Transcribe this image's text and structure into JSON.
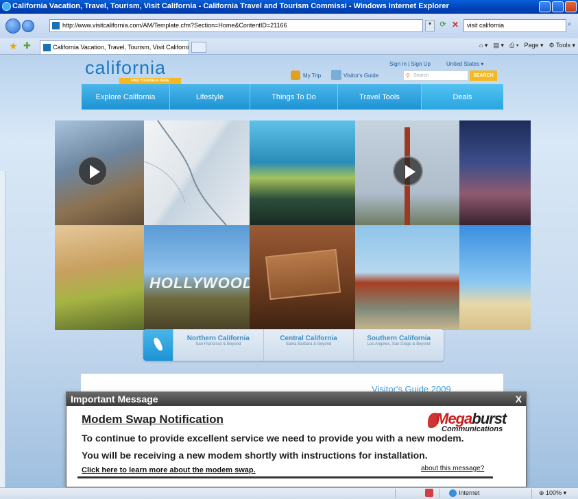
{
  "window": {
    "title": "California Vacation, Travel, Tourism, Visit California - California Travel and Tourism Commissi - Windows Internet Explorer"
  },
  "address_bar": {
    "url": "http://www.visitcalifornia.com/AM/Template.cfm?Section=Home&ContentID=21166",
    "search_value": "visit california"
  },
  "tabs": [
    {
      "label": "California Vacation, Travel, Tourism, Visit California - ..."
    }
  ],
  "command_bar": {
    "page_label": "Page",
    "tools_label": "Tools"
  },
  "site": {
    "logo_word": "california",
    "logo_tagline": "FIND YOURSELF HERE",
    "signin": "Sign In | Sign Up",
    "country": "United States",
    "my_trip": "My Trip",
    "visitors_guide": "Visitor's Guide",
    "search_placeholder": "Search",
    "search_button": "SEARCH",
    "nav": [
      "Explore California",
      "Lifestyle",
      "Things To Do",
      "Travel Tools",
      "Deals"
    ],
    "regions": [
      {
        "name": "Northern California",
        "sub": "San Francisco & Beyond"
      },
      {
        "name": "Central California",
        "sub": "Santa Barbara & Beyond"
      },
      {
        "name": "Southern California",
        "sub": "Los Angeles, San Diego & Beyond"
      }
    ],
    "guide_2009": "Visitor's Guide 2009"
  },
  "popup": {
    "header": "Important Message",
    "close": "X",
    "title": "Modem Swap Notification",
    "line1": "To continue to provide excellent service we need to provide you with a new modem.",
    "line2": "You will be receiving a new modem shortly with instructions for installation.",
    "link": "Click here to learn more about the modem swap.",
    "about": "about this message?",
    "brand_prefix": "Mega",
    "brand_suffix": "burst",
    "brand_sub": "Communications"
  },
  "status_bar": {
    "zone": "Internet",
    "zoom": "100%"
  },
  "colors": {
    "ie_blue": "#0042b8",
    "site_blue": "#1d93d4",
    "site_yellow": "#f5b820",
    "brand_red": "#c81e1e"
  }
}
